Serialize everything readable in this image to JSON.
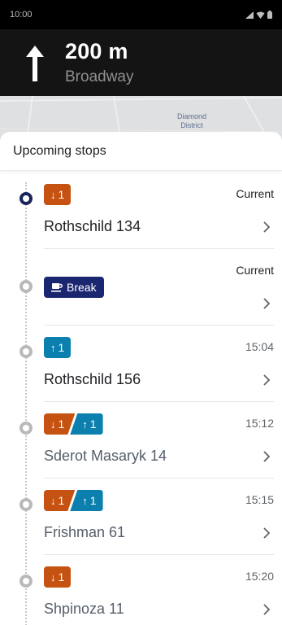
{
  "status_bar": {
    "time": "10:00",
    "icons": [
      "signal-icon",
      "wifi-icon",
      "battery-icon"
    ]
  },
  "navigation": {
    "maneuver_icon": "arrow-up-icon",
    "distance": "200 m",
    "street": "Broadway"
  },
  "map": {
    "label": "Diamond District"
  },
  "sheet": {
    "title": "Upcoming stops",
    "stops": [
      {
        "state": "current",
        "badges": [
          {
            "kind": "drop",
            "icon": "arrow-down-icon",
            "count": "1"
          }
        ],
        "time": "Current",
        "address": "Rothschild 134"
      },
      {
        "state": "current",
        "badges": [
          {
            "kind": "break",
            "icon": "coffee-cup-icon",
            "label": "Break"
          }
        ],
        "time": "Current",
        "address": ""
      },
      {
        "state": "future",
        "badges": [
          {
            "kind": "pick",
            "icon": "arrow-up-icon",
            "count": "1"
          }
        ],
        "time": "15:04",
        "address": "Rothschild 156"
      },
      {
        "state": "future",
        "badges": [
          {
            "kind": "drop",
            "icon": "arrow-down-icon",
            "count": "1"
          },
          {
            "kind": "pick",
            "icon": "arrow-up-icon",
            "count": "1"
          }
        ],
        "time": "15:12",
        "address": "Sderot Masaryk 14"
      },
      {
        "state": "future",
        "badges": [
          {
            "kind": "drop",
            "icon": "arrow-down-icon",
            "count": "1"
          },
          {
            "kind": "pick",
            "icon": "arrow-up-icon",
            "count": "1"
          }
        ],
        "time": "15:15",
        "address": "Frishman 61"
      },
      {
        "state": "future",
        "badges": [
          {
            "kind": "drop",
            "icon": "arrow-down-icon",
            "count": "1"
          }
        ],
        "time": "15:20",
        "address": "Shpinoza 11"
      }
    ]
  },
  "colors": {
    "drop": "#c55211",
    "pick": "#0b7fae",
    "break": "#1b2670",
    "current_dot": "#1a2559"
  }
}
